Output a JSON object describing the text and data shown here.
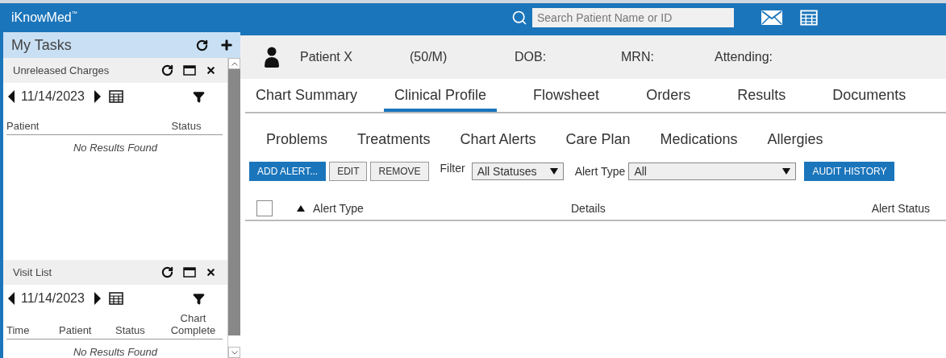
{
  "app": {
    "title": "iKnowMed",
    "trademark": "™"
  },
  "search": {
    "placeholder": "Search Patient Name or ID"
  },
  "sidebar": {
    "title": "My Tasks",
    "widgets": [
      {
        "title": "Unreleased Charges",
        "date": "11/14/2023",
        "columns": [
          "Patient",
          "Status"
        ],
        "empty_text": "No Results Found"
      },
      {
        "title": "Visit List",
        "date": "11/14/2023",
        "columns": [
          "Time",
          "Patient",
          "Status",
          "Chart Complete"
        ],
        "empty_text": "No Results Found"
      }
    ]
  },
  "patient": {
    "name": "Patient X",
    "age_sex": "(50/M)",
    "fields": [
      "DOB:",
      "MRN:",
      "Attending:"
    ]
  },
  "tabs": [
    {
      "label": "Chart Summary",
      "selected": false
    },
    {
      "label": "Clinical Profile",
      "selected": true
    },
    {
      "label": "Flowsheet",
      "selected": false
    },
    {
      "label": "Orders",
      "selected": false
    },
    {
      "label": "Results",
      "selected": false
    },
    {
      "label": "Documents",
      "selected": false
    }
  ],
  "subtabs": [
    "Problems",
    "Treatments",
    "Chart Alerts",
    "Care Plan",
    "Medications",
    "Allergies"
  ],
  "toolbar": {
    "add_button": "ADD ALERT...",
    "edit_button": "EDIT",
    "remove_button": "REMOVE",
    "filter_label": "Filter",
    "filter_value": "All Statuses",
    "type_label": "Alert Type",
    "type_value": "All",
    "audit_button": "AUDIT HISTORY"
  },
  "table": {
    "select_all_checked": false,
    "columns": [
      "Alert Type",
      "Details",
      "Alert Status"
    ]
  }
}
